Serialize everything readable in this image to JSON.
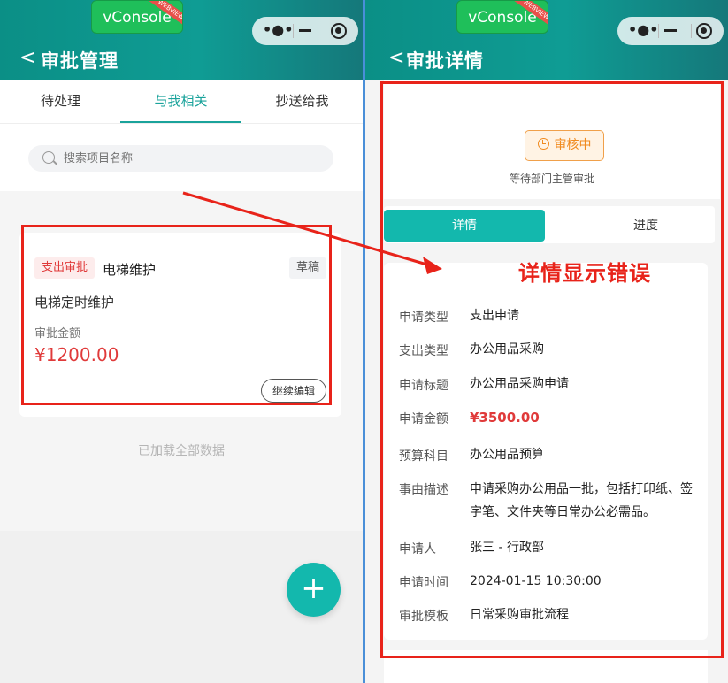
{
  "vconsole": {
    "label": "vConsole",
    "ribbon": "WEBVIEW"
  },
  "left": {
    "nav_back": "<",
    "title": "审批管理",
    "tabs": [
      {
        "label": "待处理"
      },
      {
        "label": "与我相关"
      },
      {
        "label": "抄送给我"
      }
    ],
    "search": {
      "placeholder": "搜索项目名称"
    },
    "card": {
      "type_tag": "支出审批",
      "title": "电梯维护",
      "status_tag": "草稿",
      "description": "电梯定时维护",
      "amount_label": "审批金额",
      "amount": "¥1200.00",
      "edit_button": "继续编辑"
    },
    "loaded_text": "已加载全部数据",
    "fab": "+"
  },
  "right": {
    "nav_back": "<",
    "title": "审批详情",
    "status": {
      "badge": "审核中",
      "sub": "等待部门主管审批"
    },
    "detail_tabs": [
      {
        "label": "详情"
      },
      {
        "label": "进度"
      }
    ],
    "rows": [
      {
        "label": "申请类型",
        "value": "支出申请"
      },
      {
        "label": "支出类型",
        "value": "办公用品采购"
      },
      {
        "label": "申请标题",
        "value": "办公用品采购申请"
      },
      {
        "label": "申请金额",
        "value": "¥3500.00"
      },
      {
        "label": "预算科目",
        "value": "办公用品预算"
      },
      {
        "label": "事由描述",
        "value": "申请采购办公用品一批，包括打印纸、签字笔、文件夹等日常办公必需品。"
      },
      {
        "label": "申请人",
        "value": "张三 - 行政部"
      },
      {
        "label": "申请时间",
        "value": "2024-01-15 10:30:00"
      },
      {
        "label": "审批模板",
        "value": "日常采购审批流程"
      }
    ]
  },
  "annotation": {
    "text": "详情显示错误",
    "color": "#e8231a"
  },
  "colors": {
    "primary": "#13b8ad",
    "danger": "#e03a3a",
    "warning": "#f08a1e"
  }
}
